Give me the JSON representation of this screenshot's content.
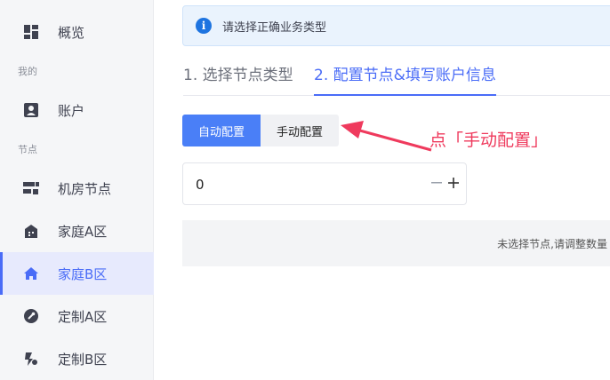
{
  "sidebar": {
    "items": [
      {
        "label": "概览",
        "icon": "dashboard-icon"
      },
      {
        "label": "账户",
        "icon": "account-icon"
      },
      {
        "label": "机房节点",
        "icon": "datacenter-node-icon"
      },
      {
        "label": "家庭A区",
        "icon": "home-a-icon"
      },
      {
        "label": "家庭B区",
        "icon": "home-b-icon"
      },
      {
        "label": "定制A区",
        "icon": "wrench-icon"
      },
      {
        "label": "定制B区",
        "icon": "custom-b-icon"
      }
    ],
    "groups": {
      "mine": "我的",
      "nodes": "节点"
    },
    "active_index": 4
  },
  "alert": {
    "text": "请选择正确业务类型",
    "icon": "info-icon"
  },
  "steps": [
    {
      "label": "1. 选择节点类型"
    },
    {
      "label": "2. 配置节点&填写账户信息"
    }
  ],
  "config_mode": {
    "auto_label": "自动配置",
    "manual_label": "手动配置",
    "selected": "auto"
  },
  "annotation": {
    "text": "点「手动配置」"
  },
  "quantity": {
    "value": "0",
    "minus": "−",
    "plus": "+"
  },
  "notice": {
    "text": "未选择节点,请调整数量"
  },
  "colors": {
    "accent": "#4a6cf7",
    "annotation": "#ef3a5d",
    "info": "#1e74e0"
  }
}
